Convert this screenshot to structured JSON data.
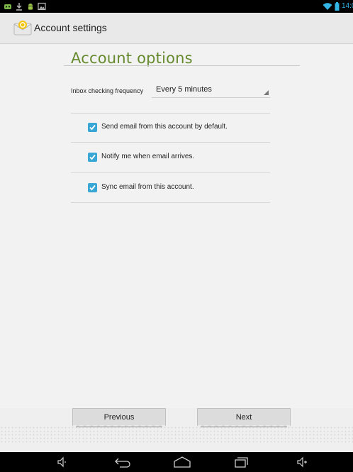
{
  "status_bar": {
    "left_icons": [
      "notification-app-icon",
      "download-icon",
      "android-icon",
      "image-icon"
    ],
    "right_icons": [
      "wifi-icon",
      "battery-icon"
    ],
    "time": "14:0"
  },
  "action_bar": {
    "title": "Account settings",
    "icon": "email-app-icon"
  },
  "main": {
    "heading": "Account options",
    "inbox_checking": {
      "label": "Inbox checking frequency",
      "value": "Every 5 minutes"
    },
    "checkboxes": [
      {
        "label": "Send email from this account by default.",
        "checked": true
      },
      {
        "label": "Notify me when email arrives.",
        "checked": true
      },
      {
        "label": "Sync email from this account.",
        "checked": true
      }
    ]
  },
  "buttons": {
    "previous": "Previous",
    "next": "Next"
  },
  "nav_bar": {
    "icons": [
      "volume-down-icon",
      "back-icon",
      "home-icon",
      "recent-apps-icon",
      "volume-up-icon"
    ]
  },
  "colors": {
    "heading": "#668a2e",
    "checkbox": "#39a7d6",
    "clock": "#33b5e5"
  }
}
